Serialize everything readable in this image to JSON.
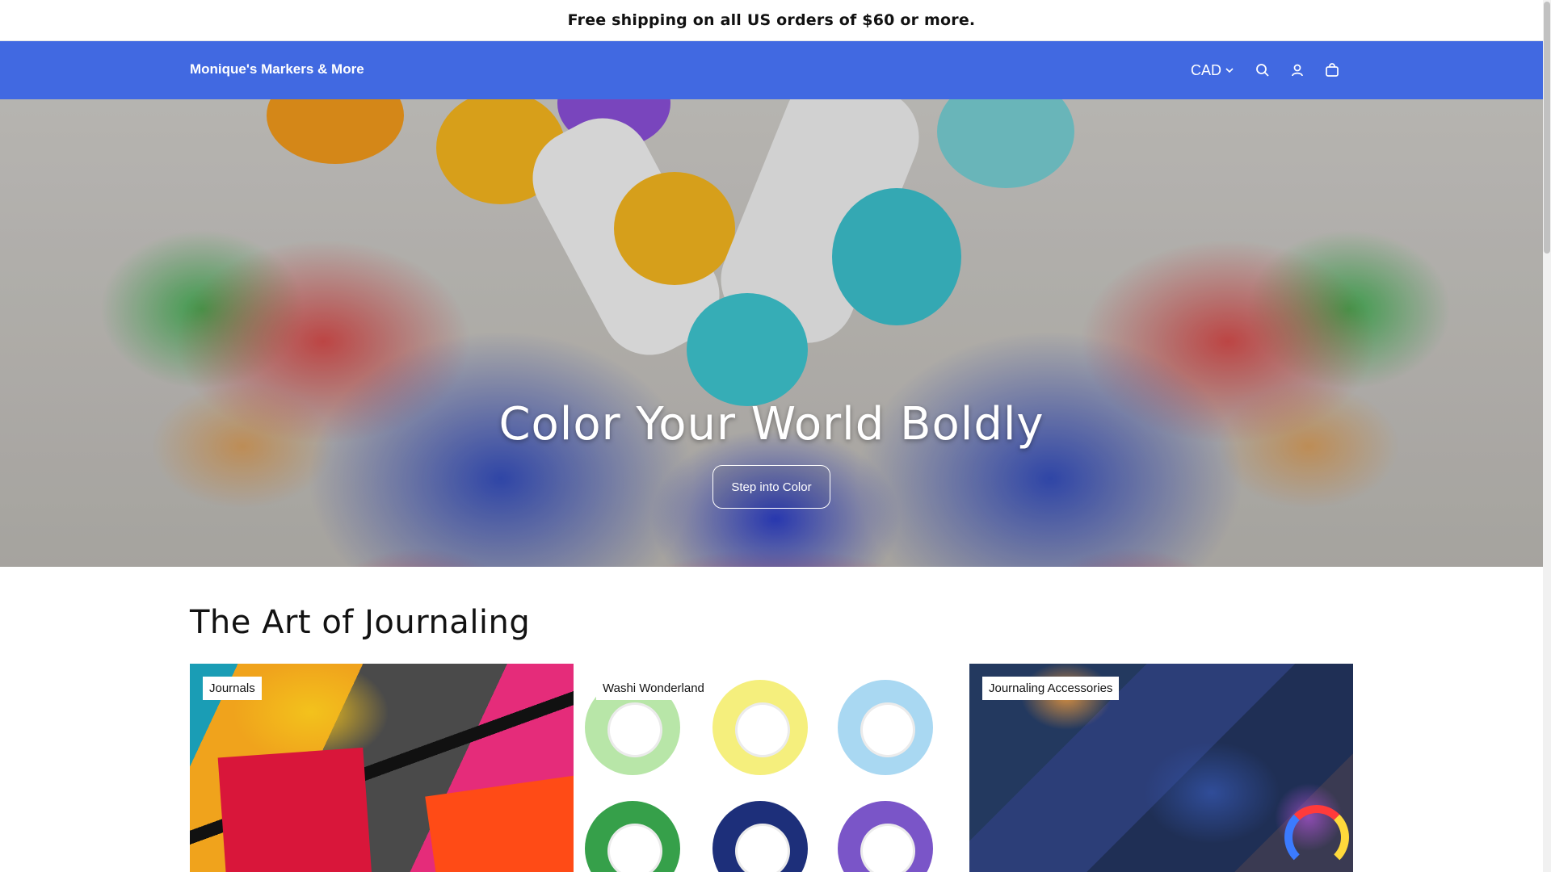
{
  "announcement": {
    "text": "Free shipping on all US orders of $60 or more."
  },
  "header": {
    "brand": "Monique's Markers & More",
    "currency": "CAD",
    "icons": [
      "search-icon",
      "account-icon",
      "cart-icon"
    ]
  },
  "hero": {
    "title": "Color Your World Boldly",
    "button_label": "Step into Color"
  },
  "collections": {
    "title": "The Art of Journaling",
    "cards": [
      {
        "label": "Journals"
      },
      {
        "label": "Washi Wonderland"
      },
      {
        "label": "Journaling Accessories"
      }
    ]
  },
  "colors": {
    "header_bg": "#4169e1",
    "text": "#121212",
    "background": "#ffffff"
  }
}
